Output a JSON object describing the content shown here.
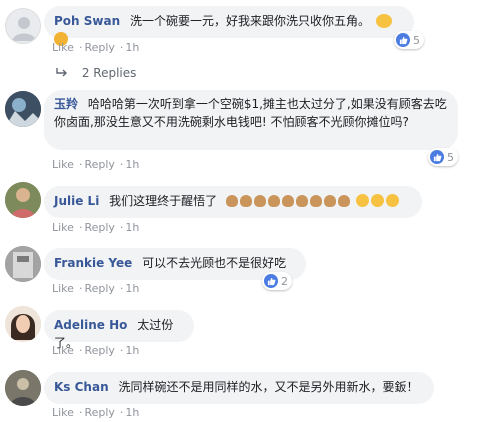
{
  "comments": [
    {
      "author": "Poh Swan",
      "text": "洗一个碗要一元，好我来跟你洗只收你五角。",
      "like_label": "Like",
      "reply_label": "Reply",
      "time": "1h",
      "reaction_count": "5"
    },
    {
      "author": "玉羚",
      "text": "哈哈哈第一次听到拿一个空碗$1,摊主也太过分了,如果没有顾客去吃你卤面,那没生意又不用洗碗剩水电钱吧! 不怕顾客不光顾你摊位吗?",
      "like_label": "Like",
      "reply_label": "Reply",
      "time": "1h",
      "reaction_count": "5"
    },
    {
      "author": "Julie Li",
      "text": "我们这理终于醒悟了",
      "like_label": "Like",
      "reply_label": "Reply",
      "time": "1h"
    },
    {
      "author": "Frankie Yee",
      "text": "可以不去光顾也不是很好吃",
      "like_label": "Like",
      "reply_label": "Reply",
      "time": "1h",
      "reaction_count": "2"
    },
    {
      "author": "Adeline Ho",
      "text": "太过份了。",
      "like_label": "Like",
      "reply_label": "Reply",
      "time": "1h"
    },
    {
      "author": "Ks Chan",
      "text": "洗同样碗还不是用同样的水，又不是另外用新水，要鈑！",
      "like_label": "Like",
      "reply_label": "Reply",
      "time": "1h"
    }
  ],
  "replies_label": "2 Replies",
  "colors": {
    "bubble": "#f2f3f5",
    "author": "#385898",
    "meta": "#90949c",
    "like_blue": "#4a7ce2"
  }
}
